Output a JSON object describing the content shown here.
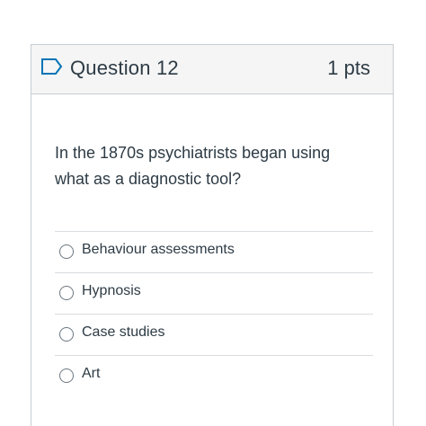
{
  "question": {
    "title": "Question 12",
    "points": "1 pts",
    "flag_icon": "bookmark-flag-icon",
    "text": "In the 1870s psychiatrists began using what as a diagnostic tool?",
    "answers": [
      {
        "label": "Behaviour assessments",
        "selected": false
      },
      {
        "label": "Hypnosis",
        "selected": false
      },
      {
        "label": "Case studies",
        "selected": false
      },
      {
        "label": "Art",
        "selected": false
      }
    ]
  },
  "colors": {
    "text": "#2d3b45",
    "header_bg": "#f5f5f5",
    "border": "#c7cdd1",
    "flag_stroke": "#0374b5"
  }
}
